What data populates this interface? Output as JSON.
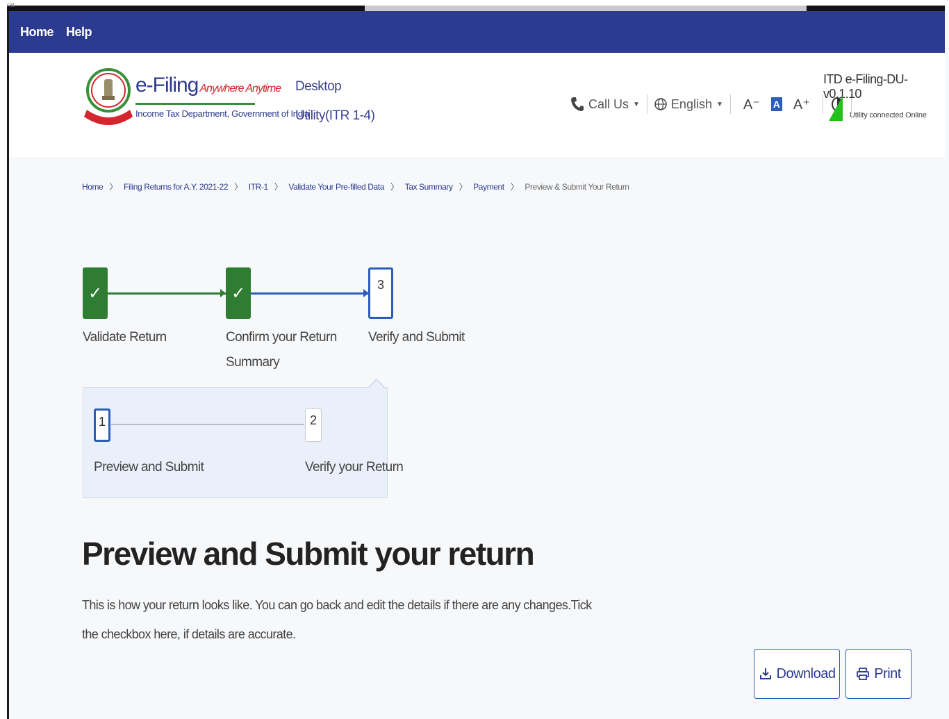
{
  "window": {
    "corner_text": "rat"
  },
  "nav": {
    "home": "Home",
    "help": "Help"
  },
  "header": {
    "logo_title": "e-Filing",
    "logo_tagline": "Anywhere Anytime",
    "logo_subtitle": "Income Tax Department, Government of India",
    "utility_line1": "Desktop",
    "utility_line2": "Utility(ITR 1-4)",
    "call_us": "Call Us",
    "language": "English",
    "font_decrease": "A⁻",
    "font_default": "A",
    "font_increase": "A⁺",
    "version": "ITD e-Filing-DU-v0.1.10",
    "connection_status": "Utility connected Online",
    "status_color": "#22c21c"
  },
  "breadcrumb": [
    "Home",
    "Filing Returns for A.Y. 2021-22",
    "ITR-1",
    "Validate Your Pre-filled Data",
    "Tax Summary",
    "Payment",
    "Preview & Submit Your Return"
  ],
  "stepper": {
    "steps": [
      {
        "label": "Validate Return",
        "status": "done"
      },
      {
        "label_line1": "Confirm your Return",
        "label_line2": "Summary",
        "status": "done"
      },
      {
        "number": "3",
        "label": "Verify and Submit",
        "status": "active"
      }
    ],
    "substeps": [
      {
        "number": "1",
        "label": "Preview and Submit",
        "status": "active"
      },
      {
        "number": "2",
        "label": "Verify your Return",
        "status": "pending"
      }
    ]
  },
  "main": {
    "title": "Preview and Submit your return",
    "description": "This is how your return looks like. You can go back and edit the details if there are any changes.Tick the checkbox here, if details are accurate."
  },
  "actions": {
    "download": "Download",
    "print": "Print"
  },
  "colors": {
    "nav_bg": "#2c3a8f",
    "done_step": "#2e7d32",
    "active_step": "#2c5db8"
  }
}
